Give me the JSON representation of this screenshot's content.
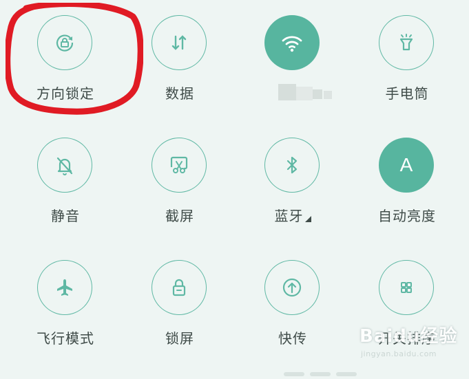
{
  "colors": {
    "accent": "#57b59f",
    "background": "#eef5f3",
    "highlight": "#e01b24"
  },
  "tiles": [
    {
      "label": "方向锁定",
      "icon": "rotation-lock-icon",
      "active": false
    },
    {
      "label": "数据",
      "icon": "data-arrows-icon",
      "active": false
    },
    {
      "label": "",
      "icon": "wifi-icon",
      "active": true
    },
    {
      "label": "手电筒",
      "icon": "flashlight-icon",
      "active": false
    },
    {
      "label": "静音",
      "icon": "bell-off-icon",
      "active": false
    },
    {
      "label": "截屏",
      "icon": "screenshot-scissors-icon",
      "active": false
    },
    {
      "label": "蓝牙",
      "icon": "bluetooth-icon",
      "active": false
    },
    {
      "label": "自动亮度",
      "icon": "auto-brightness-icon",
      "active": true,
      "glyph": "A"
    },
    {
      "label": "飞行模式",
      "icon": "airplane-icon",
      "active": false
    },
    {
      "label": "锁屏",
      "icon": "lock-icon",
      "active": false
    },
    {
      "label": "快传",
      "icon": "quick-share-icon",
      "active": false
    },
    {
      "label": "开关排序",
      "icon": "grid-icon",
      "active": false
    }
  ],
  "watermark": {
    "main": "Baidu经验",
    "sub": "jingyan.baidu.com"
  }
}
